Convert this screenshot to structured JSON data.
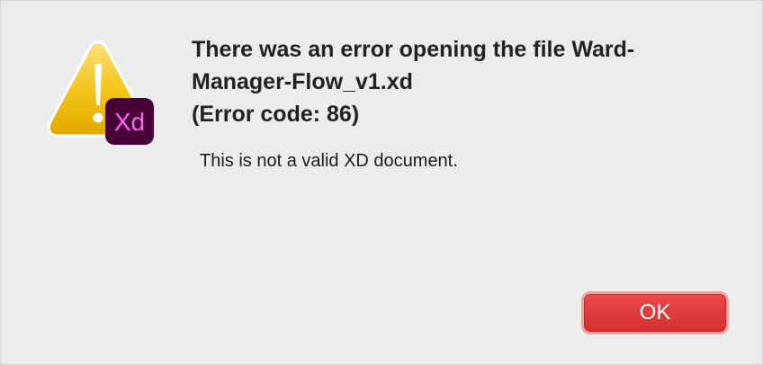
{
  "dialog": {
    "title_line1": "There was an error opening the file Ward-",
    "title_line2": "Manager-Flow_v1.xd",
    "title_line3": "(Error code: 86)",
    "message": "This is not a valid XD document.",
    "ok_label": "OK"
  },
  "icon": {
    "warning": "warning-triangle-icon",
    "badge": "xd-app-icon",
    "badge_text": "Xd",
    "badge_color": "#470137",
    "badge_text_color": "#ff61f6",
    "warning_color": "#f2c00f"
  },
  "colors": {
    "background": "#ececec",
    "ok_button": "#dc3a3a",
    "ok_text": "#ffffff"
  }
}
